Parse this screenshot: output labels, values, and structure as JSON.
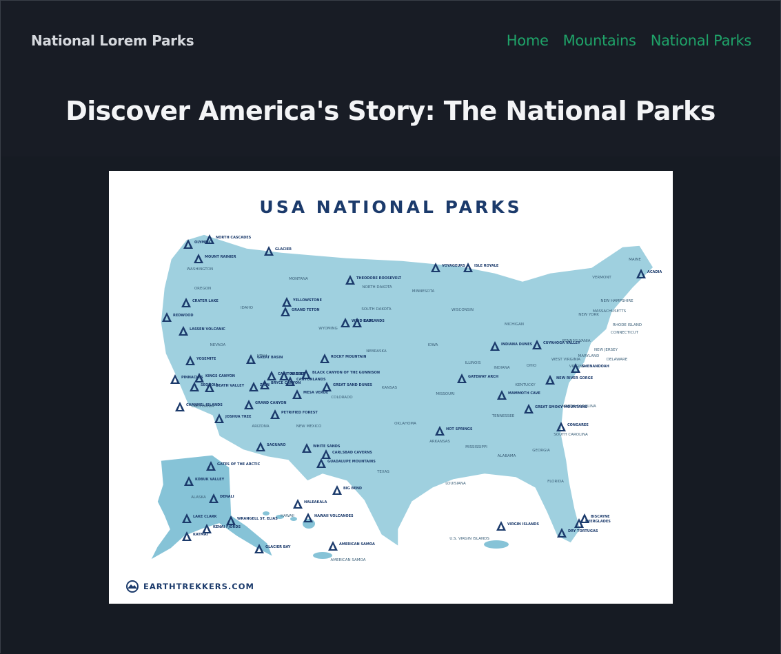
{
  "site": {
    "brand": "National Lorem Parks",
    "nav": [
      "Home",
      "Mountains",
      "National Parks"
    ]
  },
  "hero": {
    "title": "Discover America's Story: The National Parks"
  },
  "map": {
    "title": "USA NATIONAL PARKS",
    "credit": "EARTHTREKKERS.COM",
    "states": [
      "WASHINGTON",
      "OREGON",
      "CALIFORNIA",
      "NEVADA",
      "IDAHO",
      "MONTANA",
      "WYOMING",
      "UTAH",
      "ARIZONA",
      "COLORADO",
      "NEW MEXICO",
      "NORTH DAKOTA",
      "SOUTH DAKOTA",
      "NEBRASKA",
      "KANSAS",
      "OKLAHOMA",
      "TEXAS",
      "MINNESOTA",
      "IOWA",
      "MISSOURI",
      "ARKANSAS",
      "LOUISIANA",
      "WISCONSIN",
      "ILLINOIS",
      "MICHIGAN",
      "INDIANA",
      "OHIO",
      "KENTUCKY",
      "TENNESSEE",
      "MISSISSIPPI",
      "ALABAMA",
      "GEORGIA",
      "FLORIDA",
      "SOUTH CAROLINA",
      "NORTH CAROLINA",
      "VIRGINIA",
      "WEST VIRGINIA",
      "PENNSYLVANIA",
      "NEW YORK",
      "VERMONT",
      "NEW HAMPSHIRE",
      "MAINE",
      "MASSACHUSETTS",
      "RHODE ISLAND",
      "CONNECTICUT",
      "NEW JERSEY",
      "DELAWARE",
      "MARYLAND",
      "ALASKA",
      "HAWAII",
      "U.S. VIRGIN ISLANDS",
      "AMERICAN SAMOA"
    ],
    "parks": [
      "NORTH CASCADES",
      "OLYMPIC",
      "MOUNT RAINIER",
      "GLACIER",
      "CRATER LAKE",
      "REDWOOD",
      "LASSEN VOLCANIC",
      "YOSEMITE",
      "KINGS CANYON",
      "SEQUOIA",
      "PINNACLES",
      "DEATH VALLEY",
      "CHANNEL ISLANDS",
      "JOSHUA TREE",
      "GREAT BASIN",
      "YELLOWSTONE",
      "GRAND TETON",
      "ZION",
      "BRYCE CANYON",
      "CAPITOL REEF",
      "ARCHES",
      "CANYONLANDS",
      "MESA VERDE",
      "BLACK CANYON OF THE GUNNISON",
      "ROCKY MOUNTAIN",
      "GREAT SAND DUNES",
      "GRAND CANYON",
      "PETRIFIED FOREST",
      "SAGUARO",
      "WHITE SANDS",
      "CARLSBAD CAVERNS",
      "GUADALUPE MOUNTAINS",
      "BIG BEND",
      "THEODORE ROOSEVELT",
      "WIND CAVE",
      "BADLANDS",
      "VOYAGEURS",
      "ISLE ROYALE",
      "GATEWAY ARCH",
      "HOT SPRINGS",
      "INDIANA DUNES",
      "CUYAHOGA VALLEY",
      "MAMMOTH CAVE",
      "GREAT SMOKY MOUNTAINS",
      "NEW RIVER GORGE",
      "SHENANDOAH",
      "CONGAREE",
      "ACADIA",
      "BISCAYNE",
      "EVERGLADES",
      "DRY TORTUGAS",
      "GATES OF THE ARCTIC",
      "KOBUK VALLEY",
      "DENALI",
      "LAKE CLARK",
      "WRANGELL ST. ELIAS",
      "KATMAI",
      "KENAI FJORDS",
      "GLACIER BAY",
      "HALEAKALA",
      "HAWAII VOLCANOES",
      "AMERICAN SAMOA",
      "VIRGIN ISLANDS"
    ],
    "colors": {
      "title": "#1b3a6b",
      "marker": "#1b3a6b",
      "state_light": "#b3dbe6",
      "state_mid": "#86c3d7",
      "state_dark": "#5fa9c4"
    }
  }
}
